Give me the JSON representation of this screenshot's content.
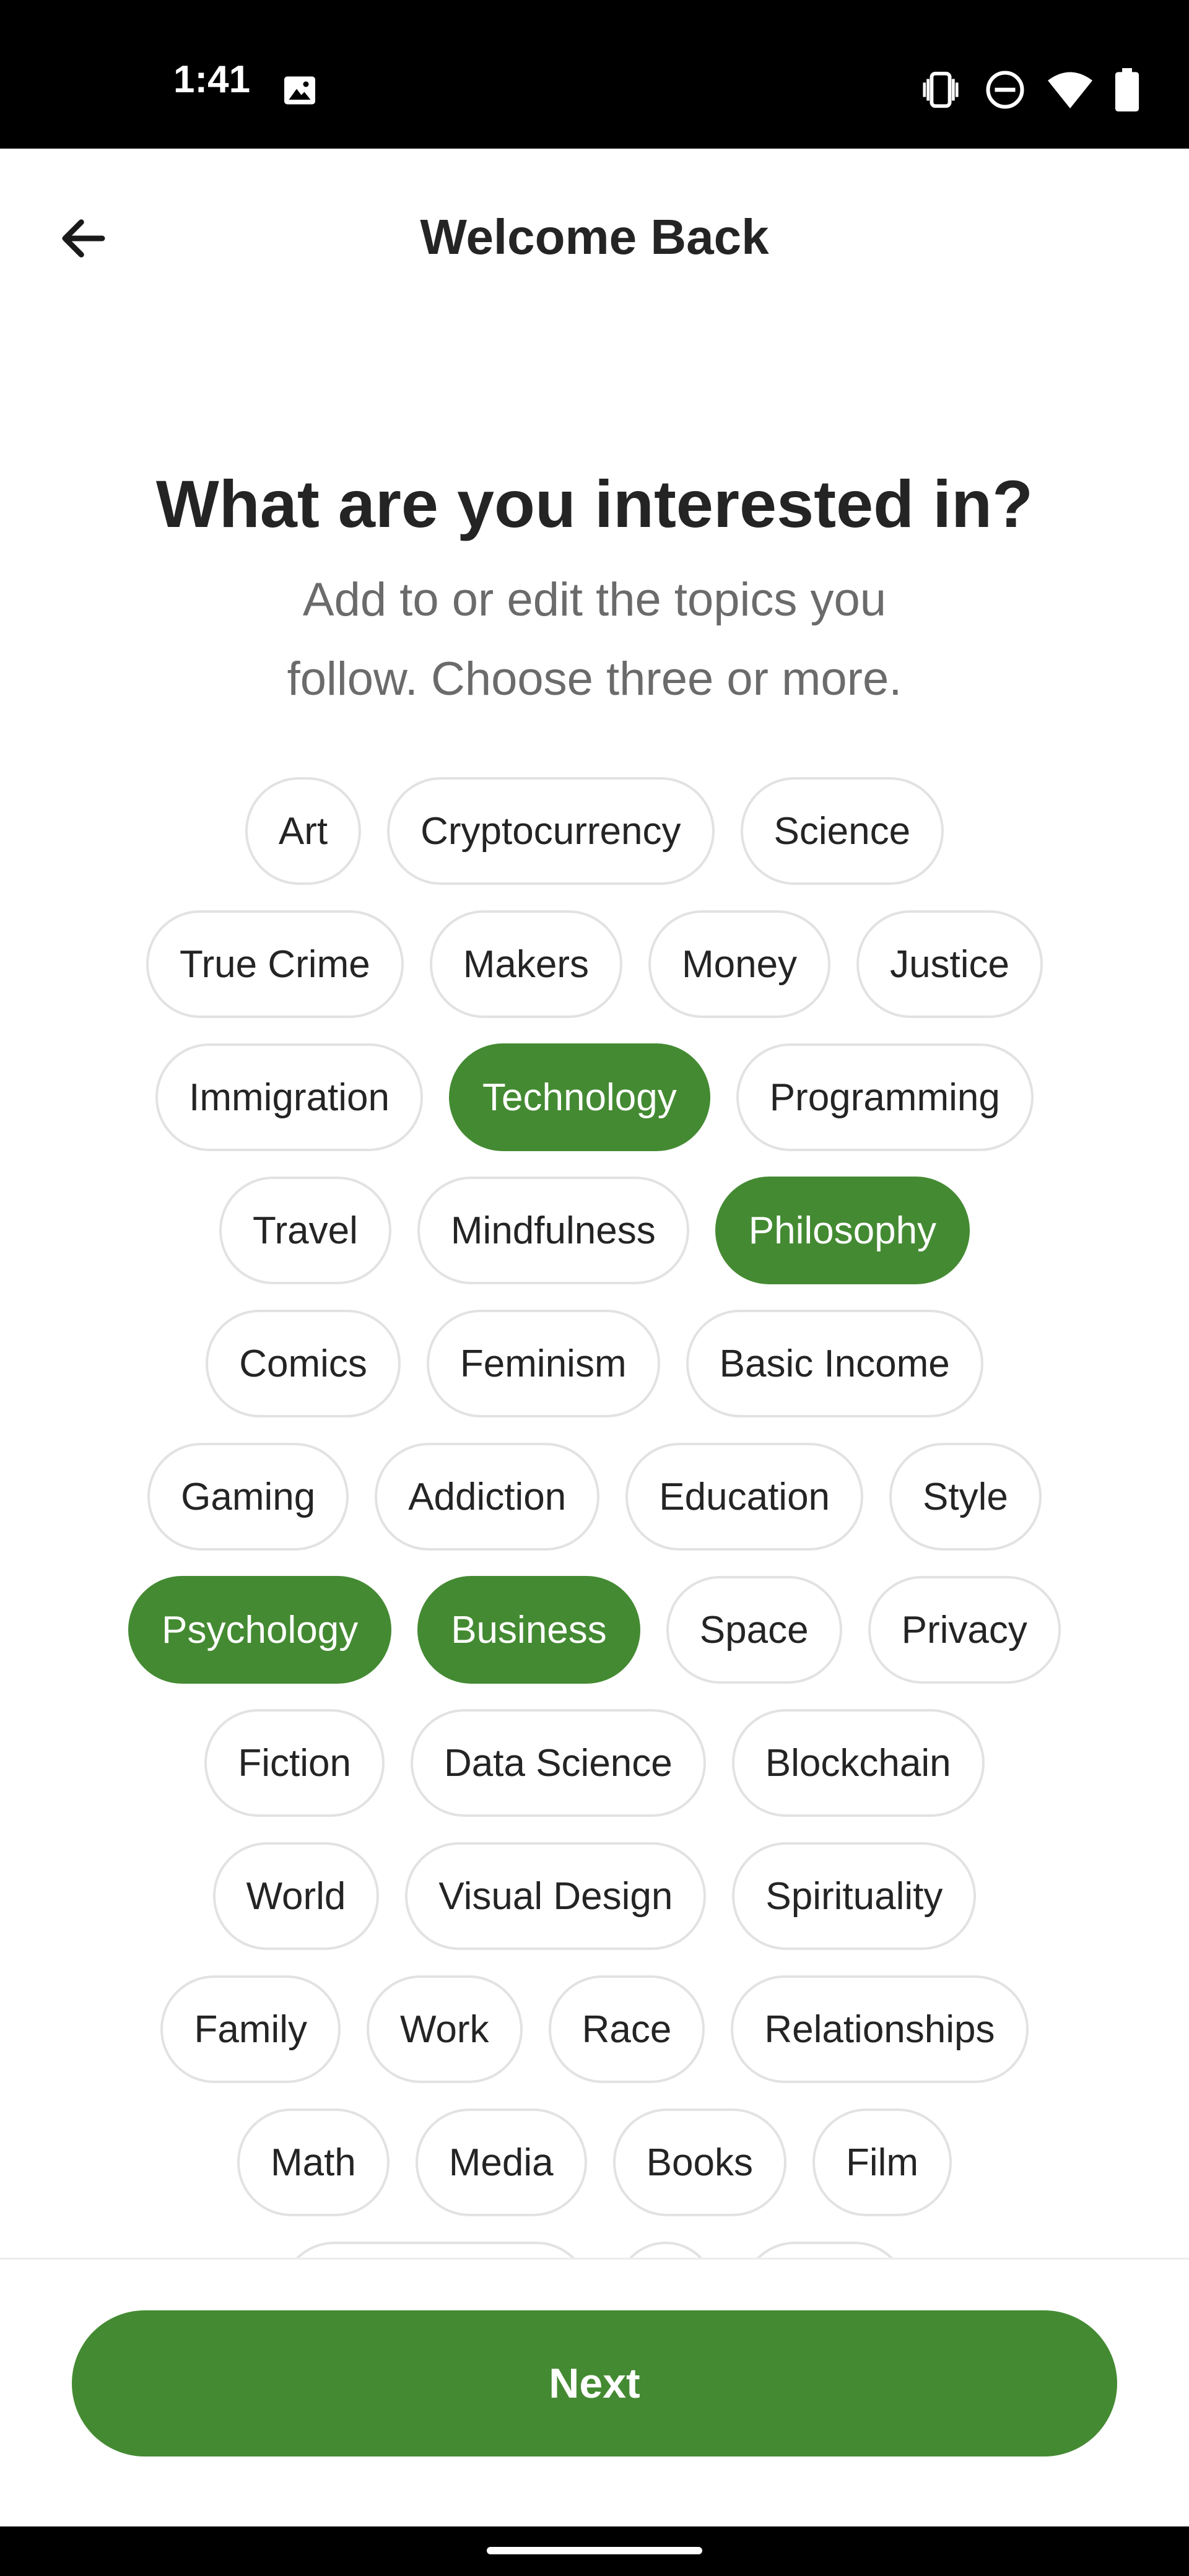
{
  "status_bar": {
    "time": "1:41",
    "icons": [
      "image-icon",
      "vibrate-icon",
      "do-not-disturb-icon",
      "wifi-icon",
      "battery-icon"
    ]
  },
  "app_bar": {
    "back_icon": "arrow-left-icon",
    "title": "Welcome Back"
  },
  "heading": "What are you interested in?",
  "subtitle_lines": [
    "Add to or edit the topics you",
    "follow. Choose three or more."
  ],
  "colors": {
    "accent": "#448a32",
    "chip_border": "#e2e2e2",
    "heading": "#242424",
    "subtitle": "#6b6b6b"
  },
  "topic_rows": [
    [
      {
        "label": "Art",
        "selected": false
      },
      {
        "label": "Cryptocurrency",
        "selected": false
      },
      {
        "label": "Science",
        "selected": false
      }
    ],
    [
      {
        "label": "True Crime",
        "selected": false
      },
      {
        "label": "Makers",
        "selected": false
      },
      {
        "label": "Money",
        "selected": false
      },
      {
        "label": "Justice",
        "selected": false
      }
    ],
    [
      {
        "label": "Immigration",
        "selected": false
      },
      {
        "label": "Technology",
        "selected": true
      },
      {
        "label": "Programming",
        "selected": false
      }
    ],
    [
      {
        "label": "Travel",
        "selected": false
      },
      {
        "label": "Mindfulness",
        "selected": false
      },
      {
        "label": "Philosophy",
        "selected": true
      }
    ],
    [
      {
        "label": "Comics",
        "selected": false
      },
      {
        "label": "Feminism",
        "selected": false
      },
      {
        "label": "Basic Income",
        "selected": false
      }
    ],
    [
      {
        "label": "Gaming",
        "selected": false
      },
      {
        "label": "Addiction",
        "selected": false
      },
      {
        "label": "Education",
        "selected": false
      },
      {
        "label": "Style",
        "selected": false
      }
    ],
    [
      {
        "label": "Psychology",
        "selected": true
      },
      {
        "label": "Business",
        "selected": true
      },
      {
        "label": "Space",
        "selected": false
      },
      {
        "label": "Privacy",
        "selected": false
      }
    ],
    [
      {
        "label": "Fiction",
        "selected": false
      },
      {
        "label": "Data Science",
        "selected": false
      },
      {
        "label": "Blockchain",
        "selected": false
      }
    ],
    [
      {
        "label": "World",
        "selected": false
      },
      {
        "label": "Visual Design",
        "selected": false
      },
      {
        "label": "Spirituality",
        "selected": false
      }
    ],
    [
      {
        "label": "Family",
        "selected": false
      },
      {
        "label": "Work",
        "selected": false
      },
      {
        "label": "Race",
        "selected": false
      },
      {
        "label": "Relationships",
        "selected": false
      }
    ],
    [
      {
        "label": "Math",
        "selected": false
      },
      {
        "label": "Media",
        "selected": false
      },
      {
        "label": "Books",
        "selected": false
      },
      {
        "label": "Film",
        "selected": false
      }
    ],
    [
      {
        "label": "",
        "selected": false
      },
      {
        "label": "",
        "selected": false
      },
      {
        "label": "",
        "selected": false
      }
    ]
  ],
  "next_button": {
    "label": "Next"
  }
}
